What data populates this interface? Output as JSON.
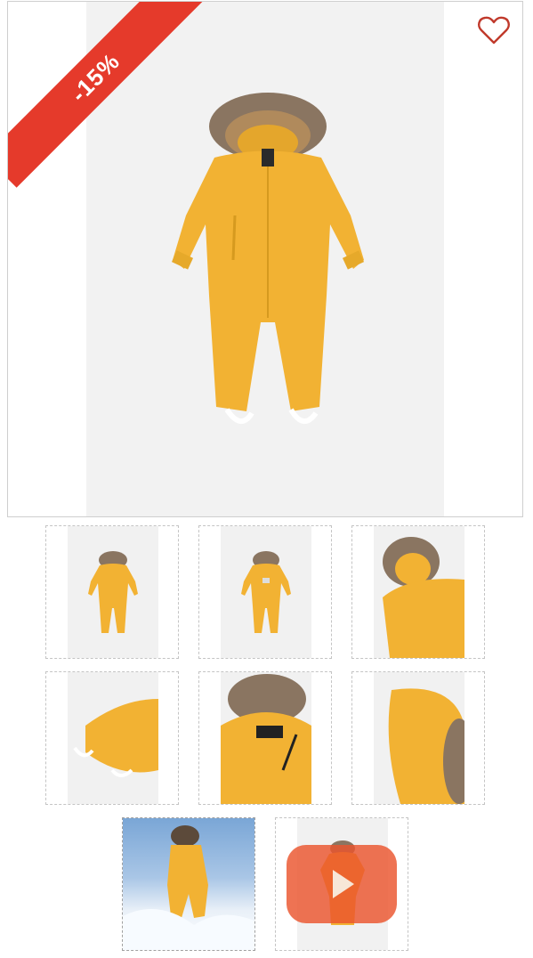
{
  "product": {
    "discount_badge": "-15%",
    "color": "#F2B233"
  },
  "colors": {
    "badge_red": "#E53A2B",
    "heart_red": "#C0392B",
    "video_play": "#EA542D"
  },
  "gallery": {
    "thumbnails": [
      {
        "name": "front-view"
      },
      {
        "name": "back-view"
      },
      {
        "name": "hood-detail"
      },
      {
        "name": "leg-cuff-detail"
      },
      {
        "name": "open-zipper-detail"
      },
      {
        "name": "hood-side-detail"
      },
      {
        "name": "lifestyle-snow"
      },
      {
        "name": "video"
      }
    ]
  }
}
